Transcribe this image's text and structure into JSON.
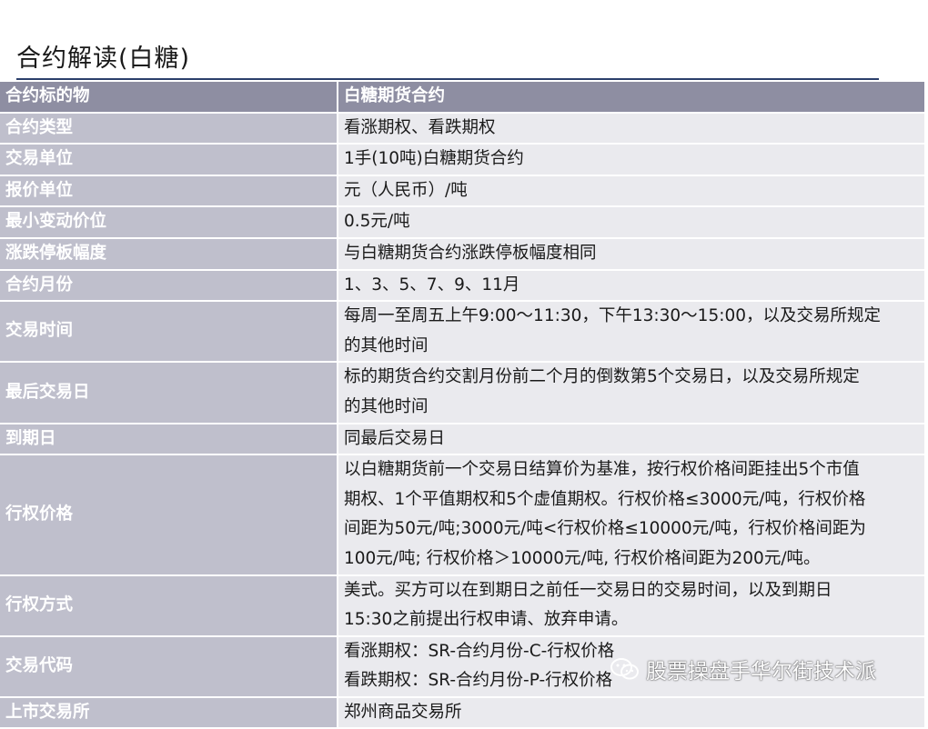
{
  "title": "合约解读(白糖)",
  "rows": [
    {
      "key": "合约标的物",
      "lines": [
        "白糖期货合约"
      ],
      "head": true
    },
    {
      "key": "合约类型",
      "lines": [
        "看涨期权、看跌期权"
      ]
    },
    {
      "key": "交易单位",
      "lines": [
        "1手(10吨)白糖期货合约"
      ]
    },
    {
      "key": "报价单位",
      "lines": [
        "元（人民币）/吨"
      ]
    },
    {
      "key": "最小变动价位",
      "lines": [
        "0.5元/吨"
      ]
    },
    {
      "key": "涨跌停板幅度",
      "lines": [
        "与白糖期货合约涨跌停板幅度相同"
      ]
    },
    {
      "key": "合约月份",
      "lines": [
        "1、3、5、7、9、11月"
      ]
    },
    {
      "key": "交易时间",
      "lines": [
        "每周一至周五上午9:00～11:30，下午13:30～15:00，以及交易所规定",
        "的其他时间"
      ]
    },
    {
      "key": "最后交易日",
      "lines": [
        "标的期货合约交割月份前二个月的倒数第5个交易日，以及交易所规定",
        "的其他时间"
      ]
    },
    {
      "key": "到期日",
      "lines": [
        "同最后交易日"
      ]
    },
    {
      "key": "行权价格",
      "lines": [
        "以白糖期货前一个交易日结算价为基准，按行权价格间距挂出5个市值",
        "期权、1个平值期权和5个虚值期权。行权价格≤3000元/吨，行权价格",
        "间距为50元/吨;3000元/吨<行权价格≤10000元/吨，行权价格间距为",
        "100元/吨; 行权价格＞10000元/吨, 行权价格间距为200元/吨。"
      ]
    },
    {
      "key": "行权方式",
      "lines": [
        "美式。买方可以在到期日之前任一交易日的交易时间，以及到期日",
        "15:30之前提出行权申请、放弃申请。"
      ]
    },
    {
      "key": "交易代码",
      "lines": [
        "看涨期权：SR-合约月份-C-行权价格",
        "看跌期权：SR-合约月份-P-行权价格"
      ]
    },
    {
      "key": "上市交易所",
      "lines": [
        "郑州商品交易所"
      ]
    }
  ],
  "watermark": {
    "text": "股票操盘手华尔街技术派",
    "icon": "wechat-icon"
  }
}
